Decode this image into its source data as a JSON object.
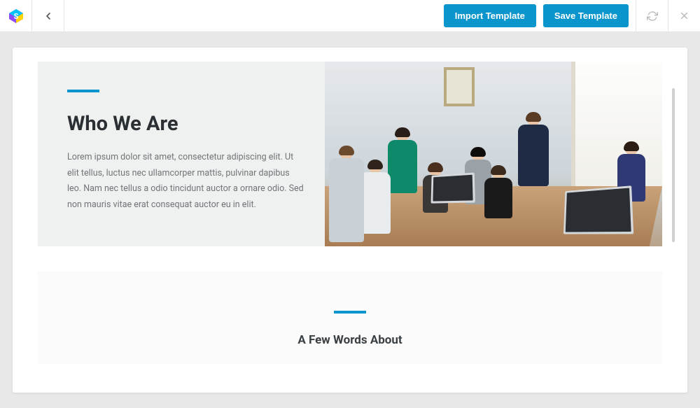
{
  "topbar": {
    "import_label": "Import Template",
    "save_label": "Save Template"
  },
  "section1": {
    "title": "Who We Are",
    "body": "Lorem ipsum dolor sit amet, consectetur adipiscing elit. Ut elit tellus, luctus nec ullamcorper mattis, pulvinar dapibus leo. Nam nec tellus a odio tincidunt auctor a ornare odio. Sed non mauris vitae erat consequat auctor eu in elit."
  },
  "section2": {
    "title": "A Few Words About"
  },
  "colors": {
    "accent": "#0a95cc"
  }
}
